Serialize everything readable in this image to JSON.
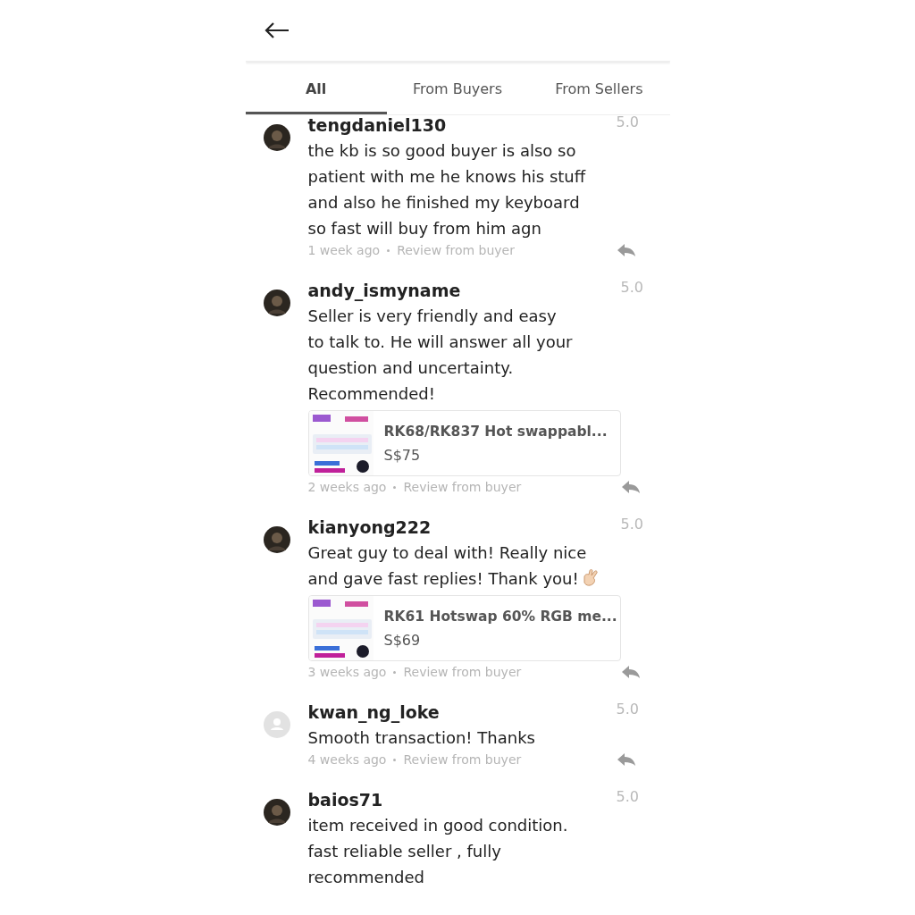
{
  "tabs": [
    {
      "label": "All",
      "selected": true
    },
    {
      "label": "From Buyers",
      "selected": false
    },
    {
      "label": "From Sellers",
      "selected": false
    }
  ],
  "reviews": [
    {
      "username": "tengdaniel130",
      "has_photo": true,
      "rating": "5.0",
      "text": "the kb is so good buyer is also so patient with me he knows his stuff and also he finished my keyboard so fast will buy from him agn",
      "time": "1 week ago",
      "source": "Review from buyer"
    },
    {
      "username": "andy_ismyname",
      "has_photo": true,
      "rating": "5.0",
      "text": "Seller is very friendly and easy to talk to. He will answer all your question and uncertainty. Recommended!",
      "product": {
        "title": "RK68/RK837 Hot swappabl...",
        "price": "S$75"
      },
      "time": "2 weeks ago",
      "source": "Review from buyer"
    },
    {
      "username": "kianyong222",
      "has_photo": true,
      "rating": "5.0",
      "text": "Great guy to deal with! Really nice and gave fast replies! Thank you!",
      "emoji": true,
      "product": {
        "title": "RK61 Hotswap 60% RGB me...",
        "price": "S$69"
      },
      "time": "3 weeks ago",
      "source": "Review from buyer"
    },
    {
      "username": "kwan_ng_loke",
      "has_photo": false,
      "rating": "5.0",
      "text": "Smooth transaction! Thanks",
      "time": "4 weeks ago",
      "source": "Review from buyer"
    },
    {
      "username": "baios71",
      "has_photo": true,
      "rating": "5.0",
      "text": "item received in good condition. fast reliable seller , fully recommended"
    }
  ]
}
